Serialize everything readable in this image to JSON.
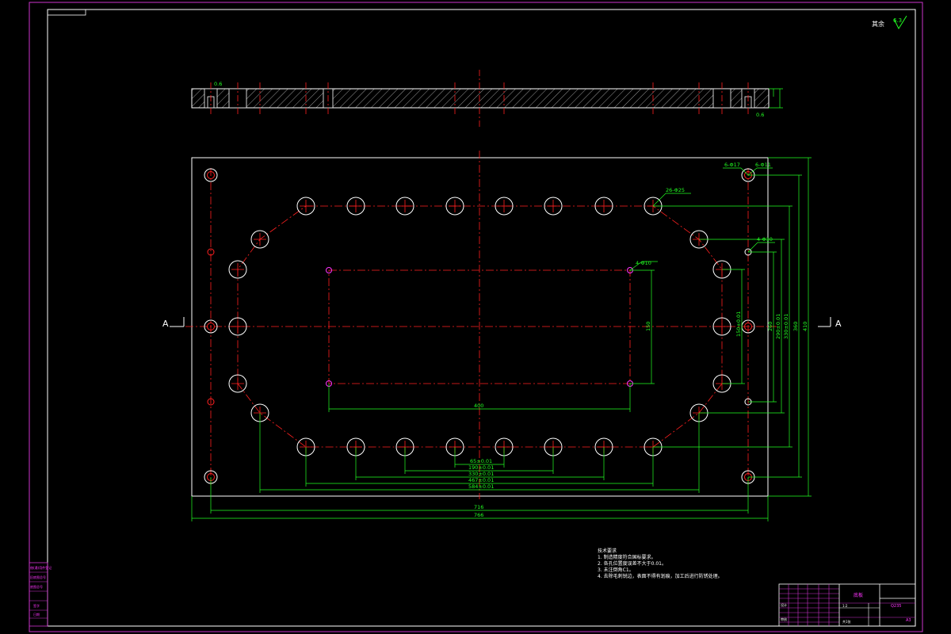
{
  "drawing": {
    "section_label_left": "A",
    "section_label_right": "A",
    "roughness_rest": "其余",
    "roughness_value": "6.3",
    "tolerance_top_left": "0.6",
    "tolerance_top_right": "0.6"
  },
  "dimensions": {
    "width_inner": "716",
    "width_outer": "766",
    "rect_width": "400",
    "rect_height": "150",
    "rect_holes": "4-Φ10",
    "pitch_1": "65±0.01",
    "pitch_2": "190±0.01",
    "pitch_3": "330±0.01",
    "pitch_4": "467±0.01",
    "pitch_5": "584±0.01",
    "bolt_circle_holes": "26-Φ25",
    "corner_holes": "6-Φ17",
    "corner_holes_b": "6-Φ11",
    "side_holes": "4-Φ10",
    "v_dim_1": "150±0.01",
    "v_dim_2": "260",
    "v_dim_3": "290±0.01",
    "v_dim_4": "330±0.01",
    "v_dim_5": "360",
    "v_dim_6": "410"
  },
  "notes": {
    "heading": "技术要求",
    "items": [
      "1. 制造精度符合国标要求。",
      "2. 各孔位置度误差不大于0.01。",
      "3. 未注倒角C1。",
      "4. 去除毛刺锐边，表面不得有划痕，加工后进行防锈处理。"
    ]
  },
  "title_block": {
    "part_name": "底板",
    "material": "Q235",
    "scale": "1:2",
    "sheet": "共1张",
    "designer": "设计",
    "checker": "审核",
    "drawing_no": "A3"
  },
  "side_block": {
    "items": [
      "借(通)用件登记",
      "旧底图总号",
      "底图总号",
      "签字",
      "日期"
    ]
  },
  "colors": {
    "background": "#000000",
    "frame": "#cc33cc",
    "geometry": "#ffffff",
    "centerline": "#ff2020",
    "dimension": "#22ff22"
  }
}
